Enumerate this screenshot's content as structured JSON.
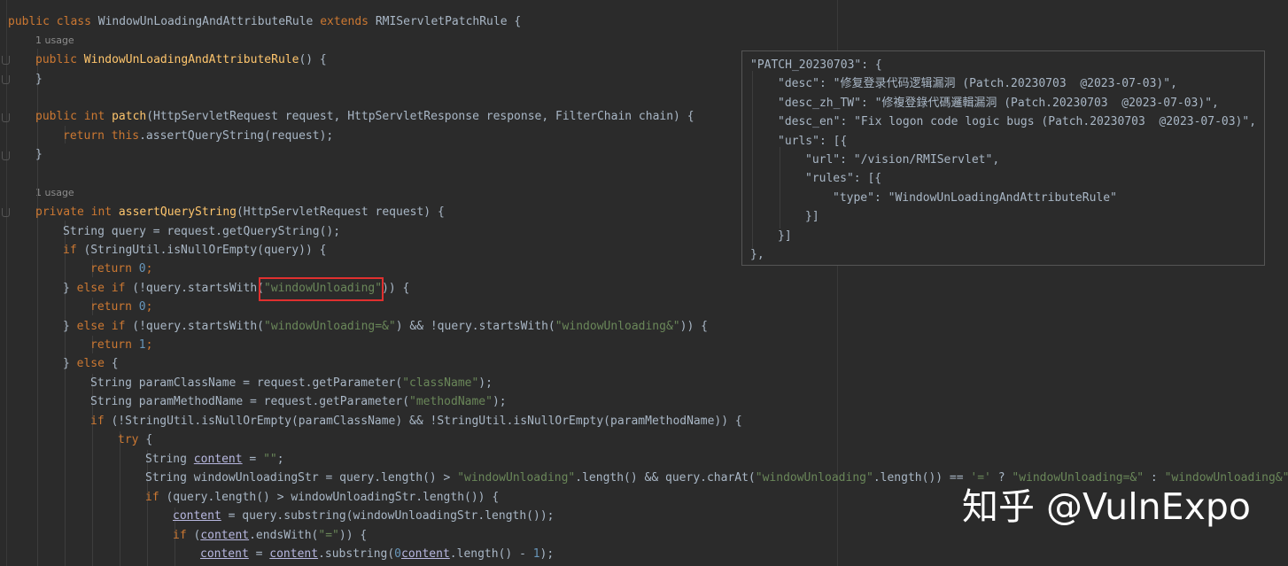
{
  "editor": {
    "usage_label": "1 usage",
    "lines": [
      {
        "indent": 0,
        "tokens": [
          [
            "kw",
            "public class "
          ],
          [
            "",
            "WindowUnLoadingAndAttributeRule "
          ],
          [
            "kw",
            "extends "
          ],
          [
            "",
            "RMIServletPatchRule {"
          ]
        ]
      },
      {
        "indent": 1,
        "tokens": [
          [
            "kw",
            "public "
          ],
          [
            "fn",
            "WindowUnLoadingAndAttributeRule"
          ],
          [
            "",
            "() {"
          ]
        ]
      },
      {
        "indent": 1,
        "tokens": [
          [
            "",
            "}"
          ]
        ]
      },
      {
        "indent": 0,
        "tokens": []
      },
      {
        "indent": 1,
        "tokens": [
          [
            "kw",
            "public int "
          ],
          [
            "fn",
            "patch"
          ],
          [
            "",
            "(HttpServletRequest request, HttpServletResponse response, FilterChain chain) {"
          ]
        ]
      },
      {
        "indent": 2,
        "tokens": [
          [
            "kw",
            "return this"
          ],
          [
            "",
            ".assertQueryString(request);"
          ]
        ]
      },
      {
        "indent": 1,
        "tokens": [
          [
            "",
            "}"
          ]
        ]
      },
      {
        "indent": 0,
        "tokens": []
      },
      {
        "indent": 1,
        "tokens": [
          [
            "kw",
            "private int "
          ],
          [
            "fn",
            "assertQueryString"
          ],
          [
            "",
            "(HttpServletRequest request) {"
          ]
        ]
      },
      {
        "indent": 2,
        "tokens": [
          [
            "",
            "String query = request.getQueryString();"
          ]
        ]
      },
      {
        "indent": 2,
        "tokens": [
          [
            "kw",
            "if "
          ],
          [
            "",
            "(StringUtil.isNullOrEmpty(query)) {"
          ]
        ]
      },
      {
        "indent": 3,
        "tokens": [
          [
            "kw",
            "return "
          ],
          [
            "num",
            "0"
          ],
          [
            "kw",
            ";"
          ]
        ]
      },
      {
        "indent": 2,
        "tokens": [
          [
            "",
            "} "
          ],
          [
            "kw",
            "else if "
          ],
          [
            "",
            "(!query.startsWith("
          ],
          [
            "str",
            "\"windowUnloading\""
          ],
          [
            "",
            ")) {"
          ]
        ]
      },
      {
        "indent": 3,
        "tokens": [
          [
            "kw",
            "return "
          ],
          [
            "num",
            "0"
          ],
          [
            "kw",
            ";"
          ]
        ]
      },
      {
        "indent": 2,
        "tokens": [
          [
            "",
            "} "
          ],
          [
            "kw",
            "else if "
          ],
          [
            "",
            "(!query.startsWith("
          ],
          [
            "str",
            "\"windowUnloading=&\""
          ],
          [
            "",
            ") && !query.startsWith("
          ],
          [
            "str",
            "\"windowUnloading&\""
          ],
          [
            "",
            ")) {"
          ]
        ]
      },
      {
        "indent": 3,
        "tokens": [
          [
            "kw",
            "return "
          ],
          [
            "num",
            "1"
          ],
          [
            "kw",
            ";"
          ]
        ]
      },
      {
        "indent": 2,
        "tokens": [
          [
            "",
            "} "
          ],
          [
            "kw",
            "else "
          ],
          [
            "",
            "{"
          ]
        ]
      },
      {
        "indent": 3,
        "tokens": [
          [
            "",
            "String paramClassName = request.getParameter("
          ],
          [
            "str",
            "\"className\""
          ],
          [
            "",
            ");"
          ]
        ]
      },
      {
        "indent": 3,
        "tokens": [
          [
            "",
            "String paramMethodName = request.getParameter("
          ],
          [
            "str",
            "\"methodName\""
          ],
          [
            "",
            ");"
          ]
        ]
      },
      {
        "indent": 3,
        "tokens": [
          [
            "kw",
            "if "
          ],
          [
            "",
            "(!StringUtil.isNullOrEmpty(paramClassName) && !StringUtil.isNullOrEmpty(paramMethodName)) {"
          ]
        ]
      },
      {
        "indent": 4,
        "tokens": [
          [
            "kw",
            "try "
          ],
          [
            "",
            "{"
          ]
        ]
      },
      {
        "indent": 5,
        "tokens": [
          [
            "",
            "String "
          ],
          [
            "var",
            "content"
          ],
          [
            "",
            " = "
          ],
          [
            "str",
            "\"\""
          ],
          [
            "",
            ";"
          ]
        ]
      },
      {
        "indent": 5,
        "tokens": [
          [
            "",
            "String windowUnloadingStr = query.length() > "
          ],
          [
            "str",
            "\"windowUnloading\""
          ],
          [
            "",
            ".length() && query.charAt("
          ],
          [
            "str",
            "\"windowUnloading\""
          ],
          [
            "",
            ".length()) == "
          ],
          [
            "str",
            "'='"
          ],
          [
            "",
            " ? "
          ],
          [
            "str",
            "\"windowUnloading=&\""
          ],
          [
            "",
            " : "
          ],
          [
            "str",
            "\"windowUnloading&\""
          ]
        ]
      },
      {
        "indent": 5,
        "tokens": [
          [
            "kw",
            "if "
          ],
          [
            "",
            "(query.length() > windowUnloadingStr.length()) {"
          ]
        ]
      },
      {
        "indent": 6,
        "tokens": [
          [
            "var",
            "content"
          ],
          [
            "",
            " = query.substring(windowUnloadingStr.length());"
          ]
        ]
      },
      {
        "indent": 6,
        "tokens": [
          [
            "kw",
            "if "
          ],
          [
            "",
            "("
          ],
          [
            "var",
            "content"
          ],
          [
            "",
            ".endsWith("
          ],
          [
            "str",
            "\"=\""
          ],
          [
            "",
            ")) {"
          ]
        ]
      },
      {
        "indent": 7,
        "tokens": [
          [
            "var",
            "content"
          ],
          [
            "",
            " = "
          ],
          [
            "var",
            "content"
          ],
          [
            "",
            ".substring("
          ],
          [
            "num",
            "0"
          ],
          [
            ", "
          ],
          [
            "var",
            "content"
          ],
          [
            "",
            ".length() - "
          ],
          [
            "num",
            "1"
          ],
          [
            "",
            ");"
          ]
        ]
      }
    ]
  },
  "json_popup": {
    "lines": [
      {
        "indent": 0,
        "text": "\"PATCH_20230703\": {"
      },
      {
        "indent": 1,
        "text": "\"desc\": \"修复登录代码逻辑漏洞 (Patch.20230703  @2023-07-03)\","
      },
      {
        "indent": 1,
        "text": "\"desc_zh_TW\": \"修複登錄代碼邏輯漏洞 (Patch.20230703  @2023-07-03)\","
      },
      {
        "indent": 1,
        "text": "\"desc_en\": \"Fix logon code logic bugs (Patch.20230703  @2023-07-03)\","
      },
      {
        "indent": 1,
        "text": "\"urls\": [{"
      },
      {
        "indent": 2,
        "text": "\"url\": \"/vision/RMIServlet\","
      },
      {
        "indent": 2,
        "text": "\"rules\": [{"
      },
      {
        "indent": 3,
        "text": "\"type\": \"WindowUnLoadingAndAttributeRule\""
      },
      {
        "indent": 2,
        "text": "}]"
      },
      {
        "indent": 1,
        "text": "}]"
      },
      {
        "indent": 0,
        "text": "},"
      }
    ]
  },
  "watermark": {
    "text": "知乎 @VulnExpo"
  },
  "colors": {
    "background": "#2b2b2b",
    "keyword": "#cc7832",
    "function": "#ffc66d",
    "string": "#6a8759",
    "number": "#6897bb",
    "text": "#a9b7c6",
    "highlight_box": "#e0302f"
  }
}
